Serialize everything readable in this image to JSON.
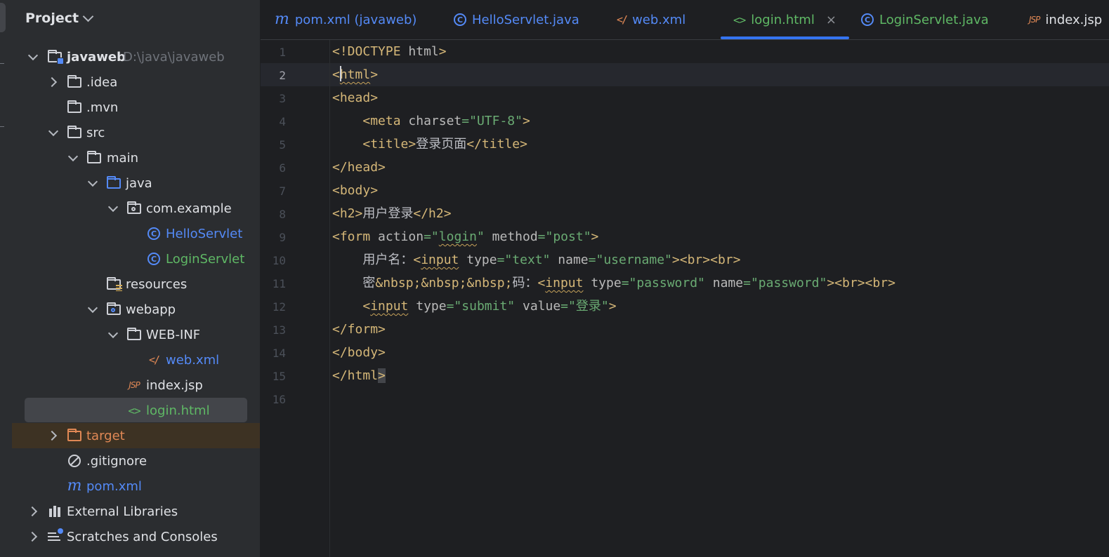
{
  "sidebar": {
    "title": "Project",
    "items": [
      {
        "label": "javaweb",
        "path": "D:\\java\\javaweb",
        "icon": "module-folder-icon"
      },
      {
        "label": ".idea",
        "icon": "folder-icon"
      },
      {
        "label": ".mvn",
        "icon": "folder-icon"
      },
      {
        "label": "src",
        "icon": "folder-icon"
      },
      {
        "label": "main",
        "icon": "folder-icon"
      },
      {
        "label": "java",
        "icon": "source-folder-icon"
      },
      {
        "label": "com.example",
        "icon": "package-icon"
      },
      {
        "label": "HelloServlet",
        "icon": "class-icon"
      },
      {
        "label": "LoginServlet",
        "icon": "class-icon"
      },
      {
        "label": "resources",
        "icon": "resources-folder-icon"
      },
      {
        "label": "webapp",
        "icon": "web-folder-icon"
      },
      {
        "label": "WEB-INF",
        "icon": "folder-icon"
      },
      {
        "label": "web.xml",
        "icon": "xml-icon"
      },
      {
        "label": "index.jsp",
        "icon": "jsp-icon"
      },
      {
        "label": "login.html",
        "icon": "html-icon"
      },
      {
        "label": "target",
        "icon": "excluded-folder-icon"
      },
      {
        "label": ".gitignore",
        "icon": "ignore-icon"
      },
      {
        "label": "pom.xml",
        "icon": "maven-icon"
      },
      {
        "label": "External Libraries",
        "icon": "library-icon"
      },
      {
        "label": "Scratches and Consoles",
        "icon": "scratches-icon"
      }
    ]
  },
  "tabs": [
    {
      "label": "pom.xml (javaweb)",
      "icon": "m"
    },
    {
      "label": "HelloServlet.java",
      "icon": "C"
    },
    {
      "label": "web.xml",
      "icon": "</"
    },
    {
      "label": "login.html",
      "icon": "<>",
      "close": "×"
    },
    {
      "label": "LoginServlet.java",
      "icon": "C"
    },
    {
      "label": "index.jsp",
      "icon": "JSP"
    }
  ],
  "editor": {
    "current_line": 2,
    "line_numbers": [
      "1",
      "2",
      "3",
      "4",
      "5",
      "6",
      "7",
      "8",
      "9",
      "10",
      "11",
      "12",
      "13",
      "14",
      "15",
      "16"
    ],
    "lines": [
      "<!DOCTYPE html>",
      "<html>",
      "<head>",
      "    <meta charset=\"UTF-8\">",
      "    <title>登录页面</title>",
      "</head>",
      "<body>",
      "<h2>用户登录</h2>",
      "<form action=\"login\" method=\"post\">",
      "    用户名：<input type=\"text\" name=\"username\"><br><br>",
      "    密&nbsp;&nbsp;&nbsp;码：<input type=\"password\" name=\"password\"><br><br>",
      "    <input type=\"submit\" value=\"登录\">",
      "</form>",
      "</body>",
      "</html>",
      ""
    ]
  },
  "colors": {
    "tag": "#d5b778",
    "string": "#6aab73",
    "attribute": "#bababa",
    "html_file": "#5fb865",
    "java_class": "#548af7",
    "tab_underline": "#3574f0"
  }
}
